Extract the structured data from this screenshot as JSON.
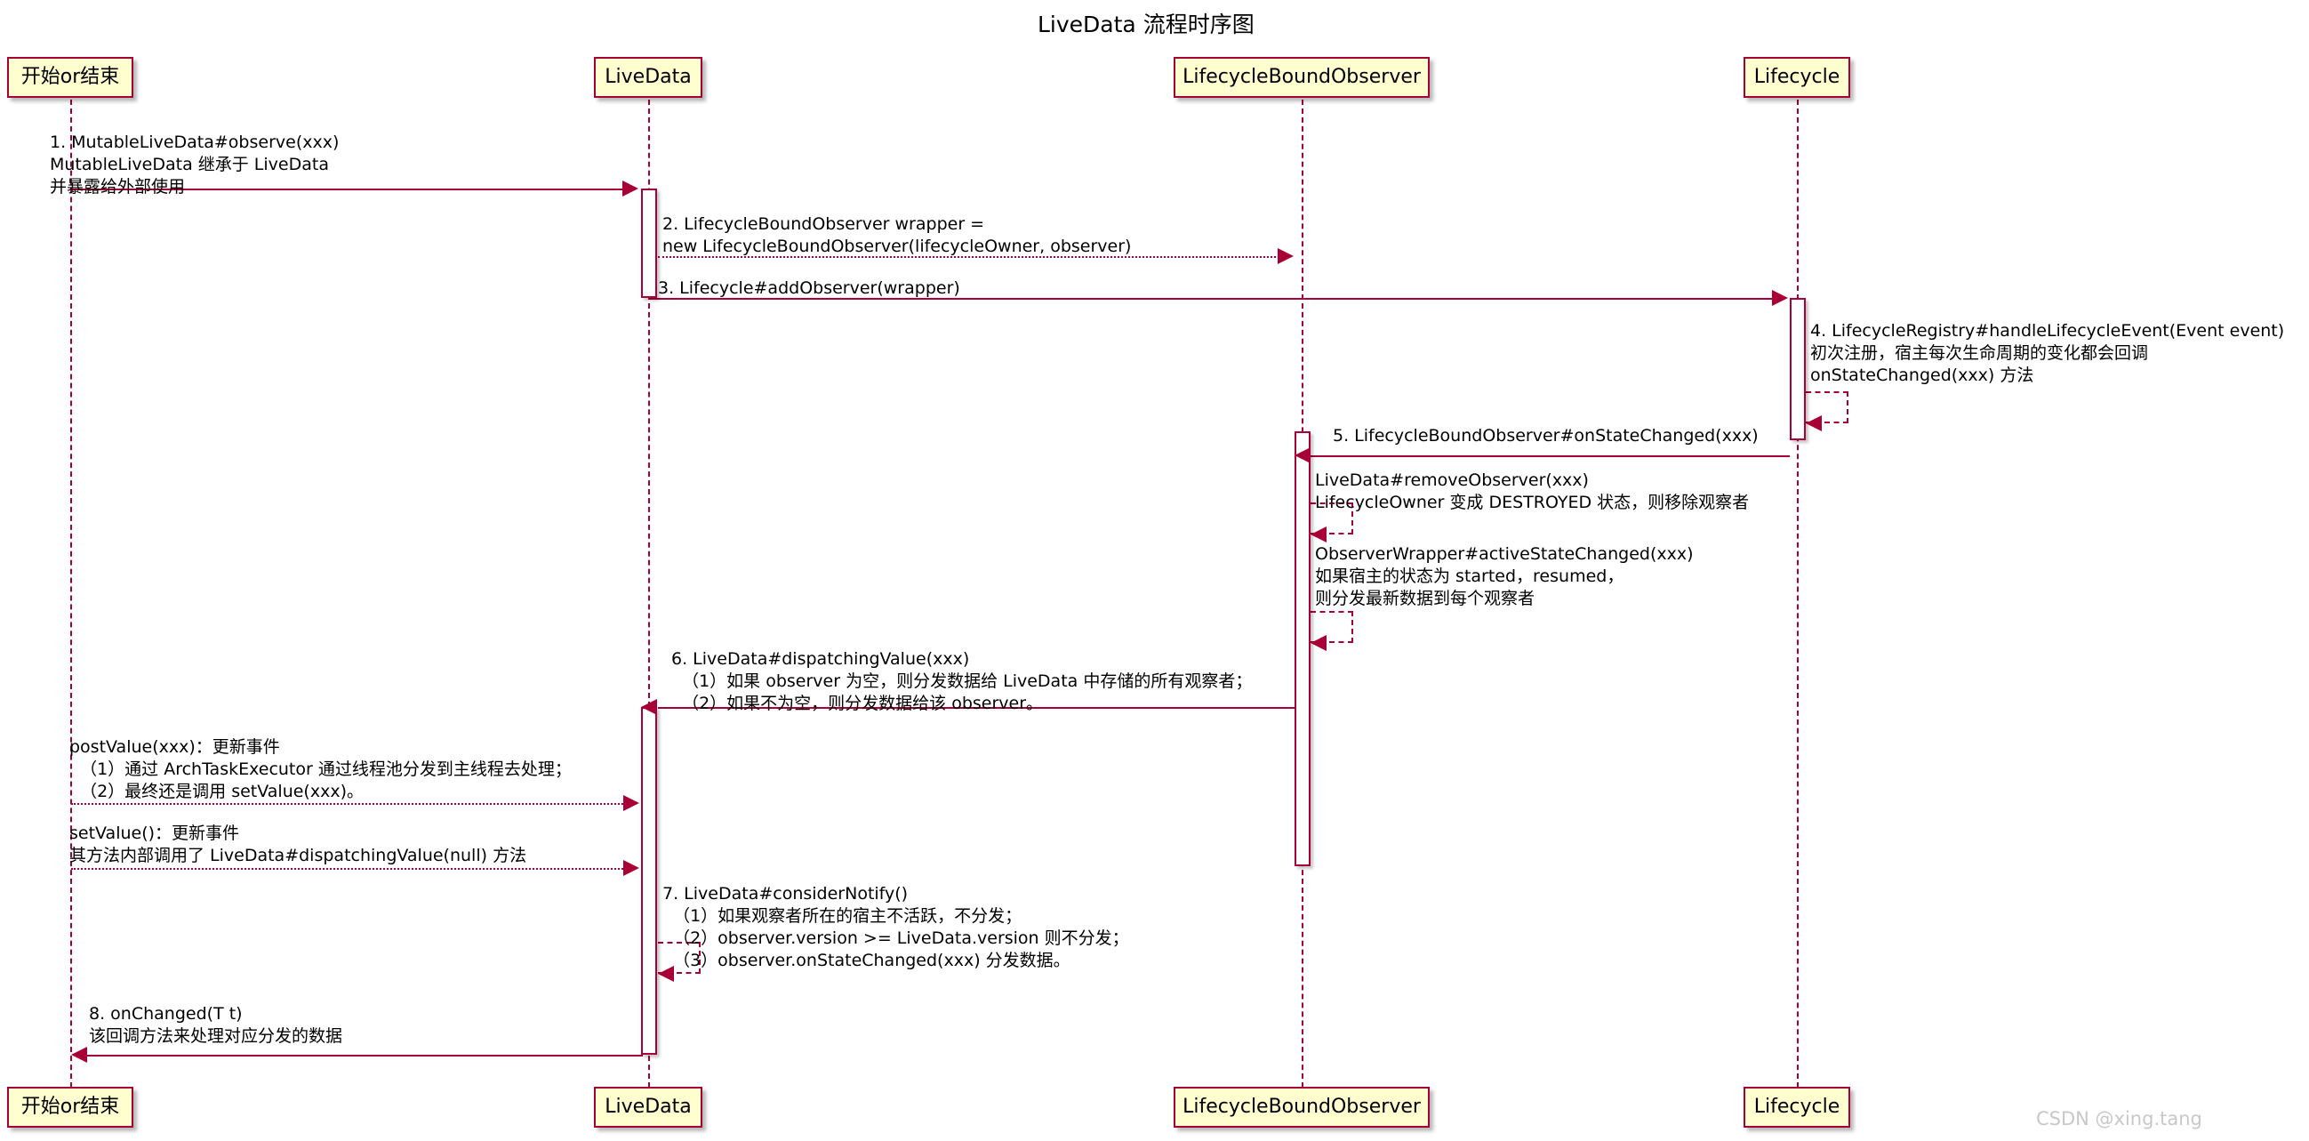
{
  "diagram": {
    "title": "LiveData 流程时序图",
    "watermark": "CSDN @xing.tang",
    "accent_color": "#A80036",
    "box_fill_color": "#FEFECE",
    "type": "uml-sequence-diagram"
  },
  "participants": [
    {
      "id": "actor",
      "label": "开始or结束"
    },
    {
      "id": "livedata",
      "label": "LiveData"
    },
    {
      "id": "lbo",
      "label": "LifecycleBoundObserver"
    },
    {
      "id": "lifecycle",
      "label": "Lifecycle"
    }
  ],
  "messages": [
    {
      "num": "1",
      "from": "actor",
      "to": "livedata",
      "style": "solid",
      "direction": "right",
      "text": "1. MutableLiveData#observe(xxx)\nMutableLiveData 继承于 LiveData\n并暴露给外部使用"
    },
    {
      "num": "2",
      "from": "livedata",
      "to": "lbo",
      "style": "dotted",
      "direction": "right",
      "text": "2. LifecycleBoundObserver wrapper =\nnew LifecycleBoundObserver(lifecycleOwner, observer)"
    },
    {
      "num": "3",
      "from": "livedata",
      "to": "lifecycle",
      "style": "solid",
      "direction": "right",
      "text": "3. Lifecycle#addObserver(wrapper)"
    },
    {
      "num": "4",
      "from": "lifecycle",
      "to": "lifecycle",
      "style": "self",
      "direction": "left",
      "text": "4. LifecycleRegistry#handleLifecycleEvent(Event event)\n初次注册，宿主每次生命周期的变化都会回调\nonStateChanged(xxx) 方法"
    },
    {
      "num": "5",
      "from": "lifecycle",
      "to": "lbo",
      "style": "solid",
      "direction": "left",
      "text": "5. LifecycleBoundObserver#onStateChanged(xxx)"
    },
    {
      "num": "",
      "from": "lbo",
      "to": "lbo",
      "style": "self",
      "direction": "left",
      "text": "LiveData#removeObserver(xxx)\nLifecycleOwner 变成 DESTROYED 状态，则移除观察者"
    },
    {
      "num": "",
      "from": "lbo",
      "to": "lbo",
      "style": "self",
      "direction": "left",
      "text": "ObserverWrapper#activeStateChanged(xxx)\n如果宿主的状态为 started，resumed，\n则分发最新数据到每个观察者"
    },
    {
      "num": "6",
      "from": "lbo",
      "to": "livedata",
      "style": "solid",
      "direction": "left",
      "text": "6. LiveData#dispatchingValue(xxx)\n（1）如果 observer 为空，则分发数据给 LiveData 中存储的所有观察者；\n（2）如果不为空，则分发数据给该 observer。"
    },
    {
      "num": "",
      "from": "actor",
      "to": "livedata",
      "style": "dotted",
      "direction": "right",
      "text": "postValue(xxx)：更新事件\n（1）通过 ArchTaskExecutor 通过线程池分发到主线程去处理；\n（2）最终还是调用 setValue(xxx)。"
    },
    {
      "num": "",
      "from": "actor",
      "to": "livedata",
      "style": "dotted",
      "direction": "right",
      "text": "setValue()：更新事件\n其方法内部调用了 LiveData#dispatchingValue(null) 方法"
    },
    {
      "num": "7",
      "from": "livedata",
      "to": "livedata",
      "style": "self",
      "direction": "left",
      "text": "7. LiveData#considerNotify()\n（1）如果观察者所在的宿主不活跃，不分发；\n（2）observer.version >= LiveData.version 则不分发；\n（3）observer.onStateChanged(xxx) 分发数据。"
    },
    {
      "num": "8",
      "from": "livedata",
      "to": "actor",
      "style": "solid",
      "direction": "left",
      "text": "8. onChanged(T t)\n该回调方法来处理对应分发的数据"
    }
  ],
  "labels": {
    "m1": "1. MutableLiveData#observe(xxx)\nMutableLiveData 继承于 LiveData\n并暴露给外部使用",
    "m2": "2. LifecycleBoundObserver wrapper =\nnew LifecycleBoundObserver(lifecycleOwner, observer)",
    "m3": "3. Lifecycle#addObserver(wrapper)",
    "m4": "4. LifecycleRegistry#handleLifecycleEvent(Event event)\n初次注册，宿主每次生命周期的变化都会回调\nonStateChanged(xxx) 方法",
    "m5": "5. LifecycleBoundObserver#onStateChanged(xxx)",
    "m5a": "LiveData#removeObserver(xxx)\nLifecycleOwner 变成 DESTROYED 状态，则移除观察者",
    "m5b": "ObserverWrapper#activeStateChanged(xxx)\n如果宿主的状态为 started，resumed，\n则分发最新数据到每个观察者",
    "m6": "6. LiveData#dispatchingValue(xxx)\n  （1）如果 observer 为空，则分发数据给 LiveData 中存储的所有观察者；\n  （2）如果不为空，则分发数据给该 observer。",
    "mpost": "postValue(xxx)：更新事件\n  （1）通过 ArchTaskExecutor 通过线程池分发到主线程去处理；\n  （2）最终还是调用 setValue(xxx)。",
    "mset": "setValue()：更新事件\n其方法内部调用了 LiveData#dispatchingValue(null) 方法",
    "m7": "7. LiveData#considerNotify()\n  （1）如果观察者所在的宿主不活跃，不分发；\n  （2）observer.version >= LiveData.version 则不分发；\n  （3）observer.onStateChanged(xxx) 分发数据。",
    "m8": "8. onChanged(T t)\n该回调方法来处理对应分发的数据"
  }
}
